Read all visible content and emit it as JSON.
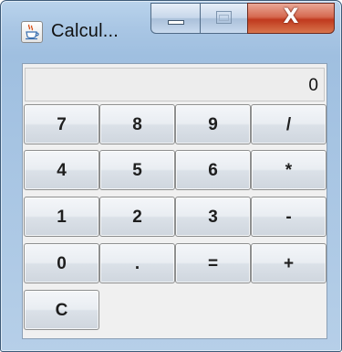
{
  "window": {
    "title": "Calcul...",
    "controls": {
      "close_glyph": "X"
    }
  },
  "display": {
    "value": "0"
  },
  "keypad": {
    "row1": [
      "7",
      "8",
      "9",
      "/"
    ],
    "row2": [
      "4",
      "5",
      "6",
      "*"
    ],
    "row3": [
      "1",
      "2",
      "3",
      "-"
    ],
    "row4": [
      "0",
      ".",
      "=",
      "+"
    ],
    "row5": [
      "C"
    ]
  },
  "colors": {
    "frame": "#a9c6e4",
    "close_button": "#c0391e",
    "panel": "#f0f0f0"
  },
  "icons": {
    "app": "java-coffee-cup-icon"
  }
}
